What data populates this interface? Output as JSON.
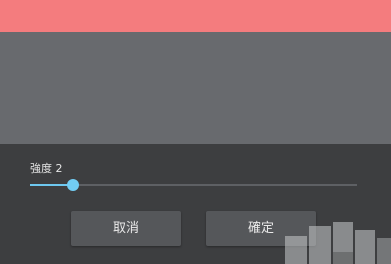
{
  "colors": {
    "preview_top": "#f47c7e",
    "preview_area": "#686a6e",
    "panel": "#3d3e40",
    "slider_accent": "#72cdf4",
    "button": "#55575a"
  },
  "strength": {
    "label": "強度 2",
    "slider_fraction": 0.13
  },
  "buttons": {
    "cancel_label": "取消",
    "ok_label": "確定"
  }
}
